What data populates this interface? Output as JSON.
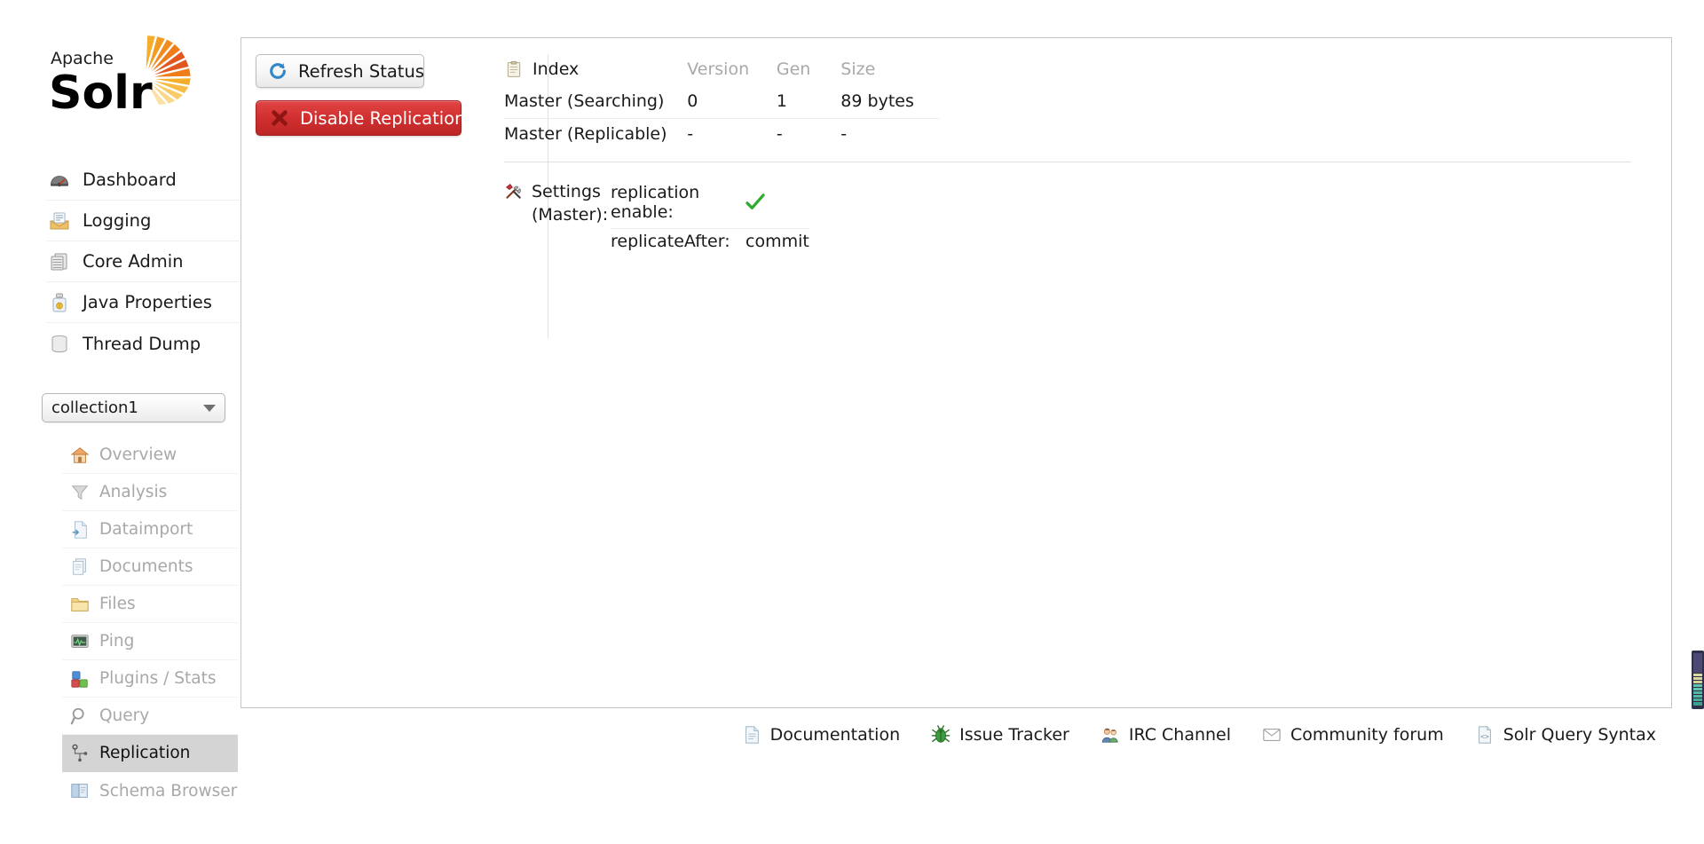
{
  "brand": {
    "line1": "Apache",
    "line2": "Solr",
    "logo_colors": [
      "#f9b233",
      "#ef7d1a",
      "#e2571e"
    ]
  },
  "sidebar": {
    "top_items": [
      {
        "label": "Dashboard",
        "icon": "dashboard-icon"
      },
      {
        "label": "Logging",
        "icon": "logging-icon"
      },
      {
        "label": "Core Admin",
        "icon": "core-admin-icon"
      },
      {
        "label": "Java Properties",
        "icon": "java-properties-icon"
      },
      {
        "label": "Thread Dump",
        "icon": "thread-dump-icon"
      }
    ],
    "core_selector": {
      "value": "collection1",
      "caret": "chevron-down-icon"
    },
    "core_items": [
      {
        "label": "Overview",
        "icon": "overview-home-icon",
        "active": false
      },
      {
        "label": "Analysis",
        "icon": "analysis-funnel-icon",
        "active": false
      },
      {
        "label": "Dataimport",
        "icon": "dataimport-icon",
        "active": false
      },
      {
        "label": "Documents",
        "icon": "documents-icon",
        "active": false
      },
      {
        "label": "Files",
        "icon": "files-folder-icon",
        "active": false
      },
      {
        "label": "Ping",
        "icon": "ping-monitor-icon",
        "active": false
      },
      {
        "label": "Plugins / Stats",
        "icon": "plugins-blocks-icon",
        "active": false
      },
      {
        "label": "Query",
        "icon": "query-magnifier-icon",
        "active": false
      },
      {
        "label": "Replication",
        "icon": "replication-nodes-icon",
        "active": true
      },
      {
        "label": "Schema Browser",
        "icon": "schema-book-icon",
        "active": false
      }
    ]
  },
  "actions": {
    "refresh_label": "Refresh Status",
    "refresh_icon": "refresh-circular-arrow-icon",
    "disable_label": "Disable Replication",
    "disable_icon": "red-x-cross-icon",
    "disable_color": "#d12f2f"
  },
  "index": {
    "title": "Index",
    "title_icon": "clipboard-icon",
    "columns": [
      "Version",
      "Gen",
      "Size"
    ],
    "rows": [
      {
        "name": "Master (Searching)",
        "version": "0",
        "gen": "1",
        "size": "89 bytes"
      },
      {
        "name": "Master (Replicable)",
        "version": "-",
        "gen": "-",
        "size": "-"
      }
    ]
  },
  "settings": {
    "label_line1": "Settings",
    "label_line2": "(Master):",
    "icon": "tools-hammer-wrench-icon",
    "rows": [
      {
        "key": "replication enable:",
        "value": "",
        "check": true,
        "check_icon": "green-check-icon",
        "check_color": "#2eaa2e"
      },
      {
        "key": "replicateAfter:",
        "value": "commit",
        "check": false
      }
    ]
  },
  "footer": {
    "links": [
      {
        "label": "Documentation",
        "icon": "document-page-icon"
      },
      {
        "label": "Issue Tracker",
        "icon": "bug-icon"
      },
      {
        "label": "IRC Channel",
        "icon": "people-group-icon"
      },
      {
        "label": "Community forum",
        "icon": "envelope-icon"
      },
      {
        "label": "Solr Query Syntax",
        "icon": "code-brackets-icon"
      }
    ]
  }
}
